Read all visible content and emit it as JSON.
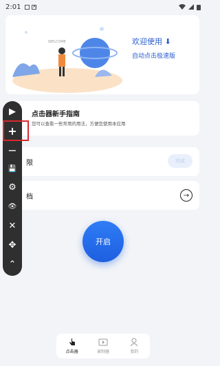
{
  "status": {
    "time": "2:01"
  },
  "banner": {
    "welcome": "欢迎使用",
    "welcome_arrow": "⬇",
    "subtitle": "自动点击极速版",
    "tag": "WELCOME"
  },
  "guide": {
    "title": "点击器新手指南",
    "description": "您可以查看一些常用的用法，方便您使用本应用"
  },
  "permission": {
    "label": "限",
    "button_label": "完成"
  },
  "document": {
    "label": "档",
    "arrow": "→"
  },
  "start_button": {
    "label": "开启"
  },
  "toolbar": {
    "items": [
      {
        "icon": "play-icon",
        "glyph": "▶"
      },
      {
        "icon": "plus-icon",
        "glyph": "+"
      },
      {
        "icon": "minus-icon",
        "glyph": "−"
      },
      {
        "icon": "save-icon",
        "glyph": "💾"
      },
      {
        "icon": "gear-icon",
        "glyph": "⚙"
      },
      {
        "icon": "eye-icon",
        "glyph": "👁"
      },
      {
        "icon": "close-icon",
        "glyph": "✕"
      },
      {
        "icon": "move-icon",
        "glyph": "✥"
      },
      {
        "icon": "chevron-up-icon",
        "glyph": "⌃"
      }
    ]
  },
  "tabs": [
    {
      "label": "点击器",
      "icon": "tap-icon",
      "active": true
    },
    {
      "label": "录制器",
      "icon": "video-icon",
      "active": false
    },
    {
      "label": "我的",
      "icon": "profile-icon",
      "active": false
    }
  ],
  "colors": {
    "accent": "#1d5fe0",
    "highlight": "#d9282f",
    "toolbar": "#2f2f2f"
  }
}
